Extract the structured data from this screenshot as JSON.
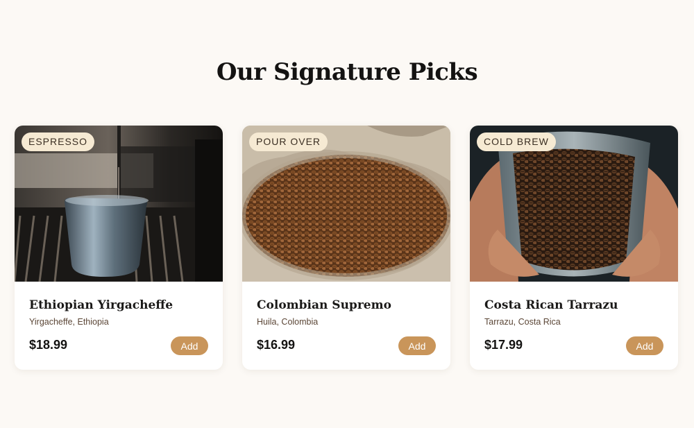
{
  "section": {
    "title": "Our Signature Picks"
  },
  "products": [
    {
      "badge": "ESPRESSO",
      "name": "Ethiopian Yirgacheffe",
      "origin": "Yirgacheffe, Ethiopia",
      "price": "$18.99",
      "button_label": "Add",
      "image": "espresso-machine-photo"
    },
    {
      "badge": "POUR OVER",
      "name": "Colombian Supremo",
      "origin": "Huila, Colombia",
      "price": "$16.99",
      "button_label": "Add",
      "image": "coffee-beans-burlap-sack-photo"
    },
    {
      "badge": "COLD BREW",
      "name": "Costa Rican Tarrazu",
      "origin": "Tarrazu, Costa Rica",
      "price": "$17.99",
      "button_label": "Add",
      "image": "coffee-bag-in-hands-photo"
    }
  ],
  "colors": {
    "background": "#fcf9f5",
    "badge_background": "#f6ead3",
    "button_accent": "#c9955a"
  }
}
